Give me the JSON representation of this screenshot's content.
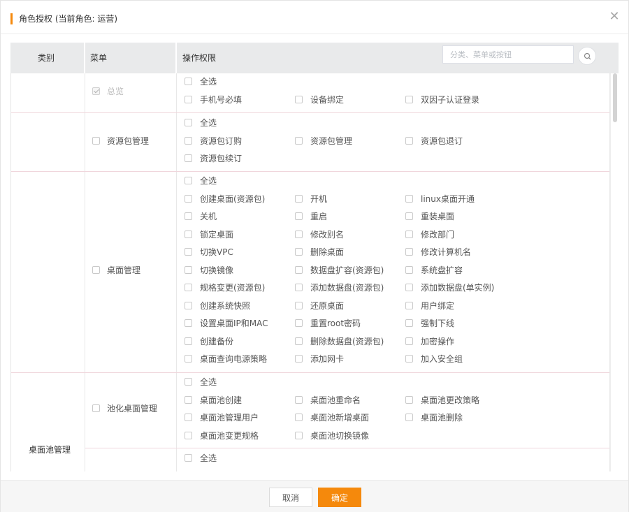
{
  "dialog": {
    "title": "角色授权 (当前角色: 运营)",
    "accent_color": "#f5890c"
  },
  "table": {
    "headers": {
      "category": "类别",
      "menu": "菜单",
      "permissions": "操作权限"
    },
    "search_placeholder": "分类、菜单或按钮"
  },
  "categories": [
    {
      "label": ""
    },
    {
      "label": ""
    },
    {
      "label": ""
    },
    {
      "label": "桌面池管理"
    }
  ],
  "menus": [
    {
      "label": "总览",
      "checked": true,
      "disabled": true
    },
    {
      "label": "资源包管理",
      "checked": false,
      "disabled": false
    },
    {
      "label": "桌面管理",
      "checked": false,
      "disabled": false
    },
    {
      "label": "池化桌面管理",
      "checked": false,
      "disabled": false
    },
    {
      "label": "",
      "checked": false,
      "disabled": false
    }
  ],
  "permission_groups": [
    {
      "select_all": "全选",
      "items": [
        "手机号必填",
        "设备绑定",
        "双因子认证登录"
      ]
    },
    {
      "select_all": "全选",
      "items": [
        "资源包订购",
        "资源包管理",
        "资源包退订",
        "资源包续订"
      ]
    },
    {
      "select_all": "全选",
      "items": [
        "创建桌面(资源包)",
        "开机",
        "linux桌面开通",
        "关机",
        "重启",
        "重装桌面",
        "锁定桌面",
        "修改别名",
        "修改部门",
        "切换VPC",
        "删除桌面",
        "修改计算机名",
        "切换镜像",
        "数据盘扩容(资源包)",
        "系统盘扩容",
        "规格变更(资源包)",
        "添加数据盘(资源包)",
        "添加数据盘(单实例)",
        "创建系统快照",
        "还原桌面",
        "用户绑定",
        "设置桌面IP和MAC",
        "重置root密码",
        "强制下线",
        "创建备份",
        "删除数据盘(资源包)",
        "加密操作",
        "桌面查询电源策略",
        "添加网卡",
        "加入安全组"
      ]
    },
    {
      "select_all": "全选",
      "items": [
        "桌面池创建",
        "桌面池重命名",
        "桌面池更改策略",
        "桌面池管理用户",
        "桌面池新增桌面",
        "桌面池删除",
        "桌面池变更规格",
        "桌面池切换镜像"
      ]
    },
    {
      "select_all": "全选",
      "items": []
    }
  ],
  "footer": {
    "cancel_label": "取消",
    "ok_label": "确定"
  }
}
